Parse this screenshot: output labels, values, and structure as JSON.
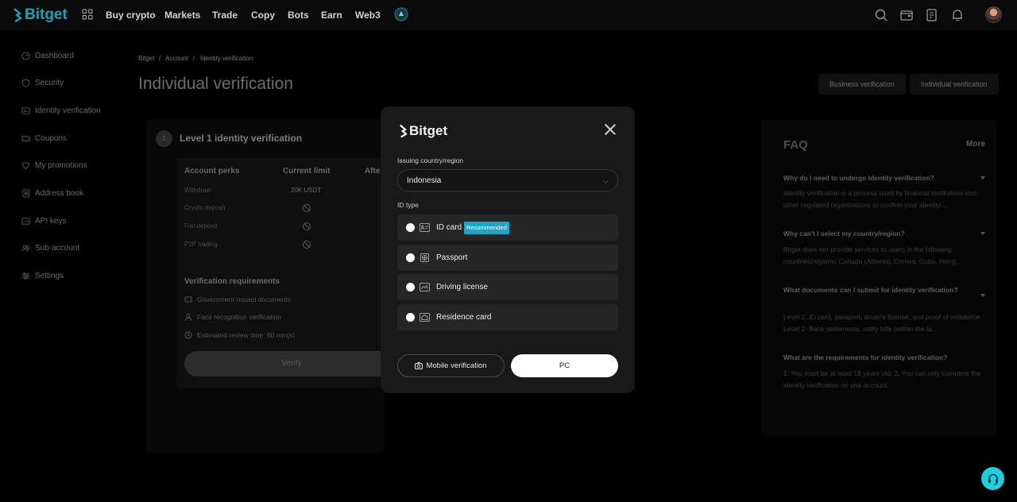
{
  "topnav": {
    "brand": "Bitget",
    "items": [
      "Buy crypto",
      "Markets",
      "Trade",
      "Copy",
      "Bots",
      "Earn",
      "Web3"
    ],
    "tool_icons": [
      "search-icon",
      "wallet-icon",
      "orders-icon",
      "bell-icon"
    ]
  },
  "sidebar": {
    "items": [
      {
        "label": "Dashboard",
        "icon": "dashboard-icon"
      },
      {
        "label": "Security",
        "icon": "shield-icon"
      },
      {
        "label": "Identity verification",
        "icon": "id-card-icon"
      },
      {
        "label": "Coupons",
        "icon": "coupon-icon"
      },
      {
        "label": "My promotions",
        "icon": "heart-icon"
      },
      {
        "label": "Address book",
        "icon": "address-book-icon"
      },
      {
        "label": "API keys",
        "icon": "key-icon"
      },
      {
        "label": "Sub-account",
        "icon": "users-icon"
      },
      {
        "label": "Settings",
        "icon": "settings-icon"
      }
    ]
  },
  "breadcrumb": [
    "Bitget",
    "Account",
    "Identity verification"
  ],
  "breadcrumb_sep": "/",
  "page_title": "Individual verification",
  "tabs": [
    "Business verification",
    "Individual verification"
  ],
  "level": {
    "number": "1",
    "title": "Level 1 identity verification",
    "headers": [
      "Account perks",
      "Current limit",
      "Afte"
    ],
    "rows": [
      {
        "perk": "Withdraw",
        "current": "20K USDT"
      },
      {
        "perk": "Crypto deposit",
        "current": ""
      },
      {
        "perk": "Fiat deposit",
        "current": ""
      },
      {
        "perk": "P2P trading",
        "current": ""
      }
    ],
    "requirements_title": "Verification requirements",
    "requirements": [
      {
        "label": "Government-issued documents",
        "icon": "document-icon"
      },
      {
        "label": "Face recognition verification",
        "icon": "user-icon"
      },
      {
        "label": "Estimated review time: 60 min(s)",
        "icon": "clock-icon"
      }
    ],
    "verify_label": "Verify"
  },
  "faq": {
    "title": "FAQ",
    "more": "More",
    "items": [
      {
        "q": "Why do I need to undergo identity verification?",
        "a": "Identity verification is a process used by financial institutions and other regulated organizations to confirm your identity...."
      },
      {
        "q": "Why can't I select my country/region?",
        "a": "Bitget does not provide services to users in the following countries/regions: Canada (Alberta), Crimea, Cuba, Hong..."
      },
      {
        "q": "What documents can I submit for identity verification?",
        "a": "Level 1: ID card, passport, driver's license, and proof of residence. Level 2: Bank statements, utility bills (within the la..."
      },
      {
        "q": "What are the requirements for identity verification?",
        "a": "1. You must be at least 18 years old. 2. You can only complete the identity verification on one account."
      }
    ]
  },
  "modal": {
    "brand": "Bitget",
    "country_label": "Issuing country/region",
    "country_value": "Indonesia",
    "id_type_label": "ID type",
    "options": [
      {
        "label": "ID card",
        "icon": "id-card-icon",
        "badge": "Recommended"
      },
      {
        "label": "Passport",
        "icon": "passport-icon"
      },
      {
        "label": "Driving license",
        "icon": "license-icon"
      },
      {
        "label": "Residence card",
        "icon": "residence-card-icon"
      }
    ],
    "mobile_button": "Mobile verification",
    "pc_button": "PC"
  },
  "colors": {
    "brand": "#1da2b4",
    "badge": "#1ba7c5",
    "support": "#1fcfe0"
  }
}
